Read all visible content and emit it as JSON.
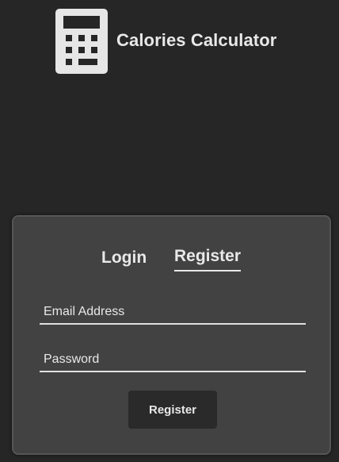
{
  "app": {
    "title": "Calories Calculator",
    "icon": "calculator-icon"
  },
  "auth": {
    "tabs": [
      {
        "label": "Login",
        "active": false
      },
      {
        "label": "Register",
        "active": true
      }
    ],
    "email_placeholder": "Email Address",
    "password_placeholder": "Password",
    "submit_label": "Register"
  },
  "colors": {
    "background": "#262626",
    "card": "#424242",
    "text": "#e8e8e8",
    "button": "#2a2a2a"
  }
}
